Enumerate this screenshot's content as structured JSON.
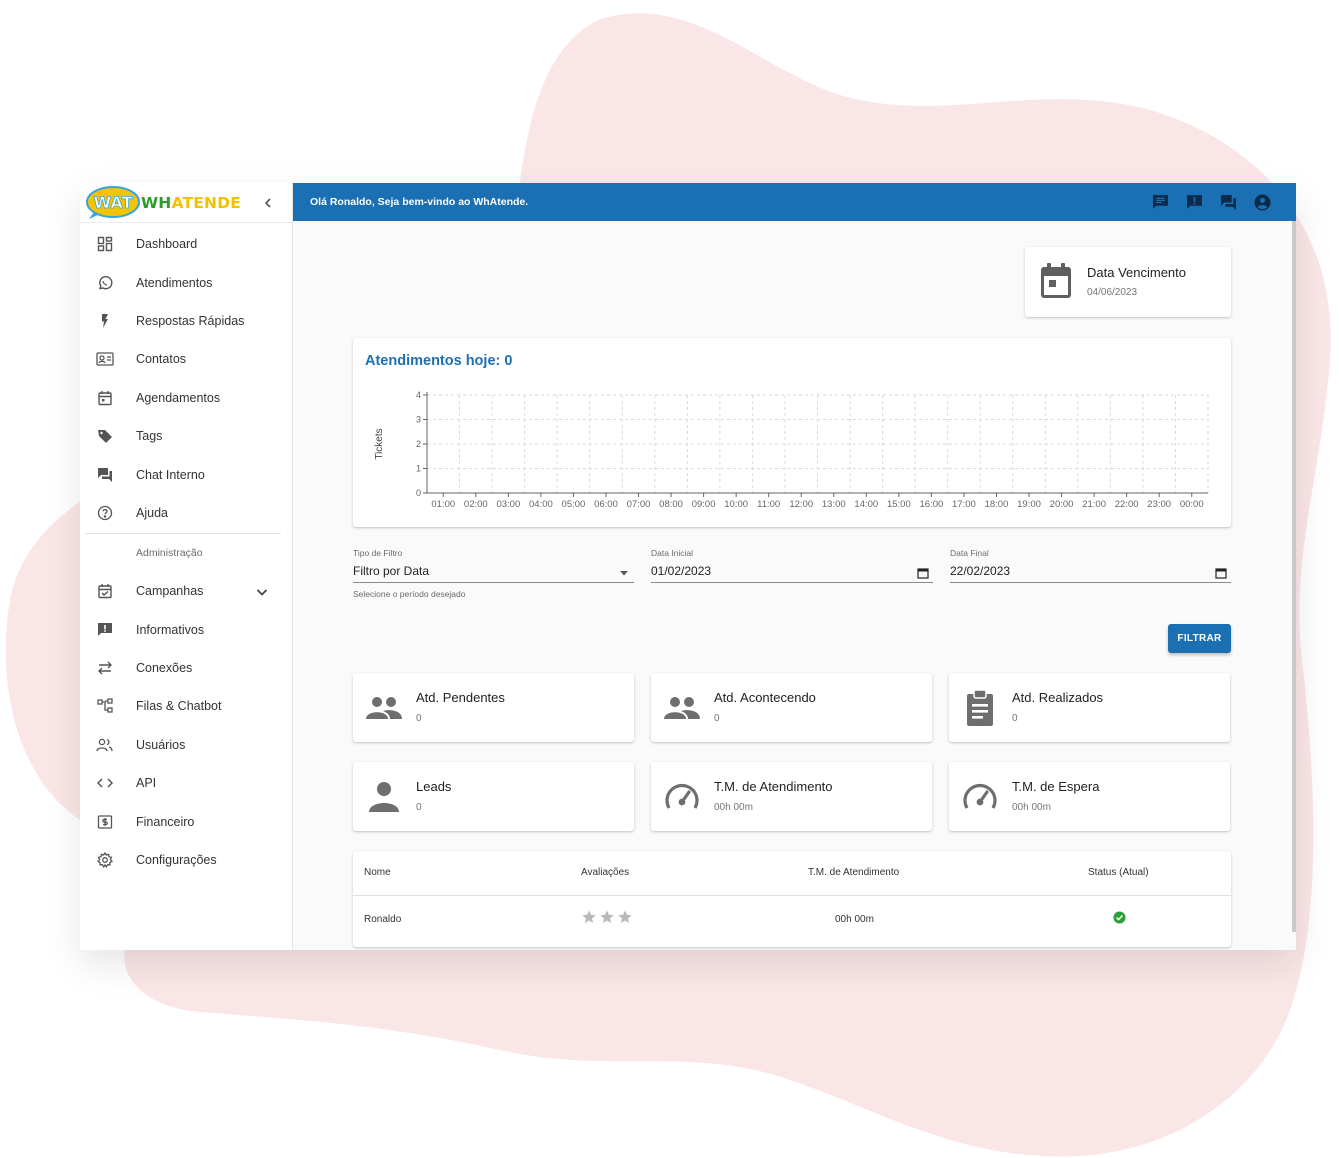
{
  "brand": {
    "logo_badge": "WAT",
    "logo_name_part1": "WH",
    "logo_name_part2": "ATENDE",
    "logo_icon": "wat-logo-icon"
  },
  "sidebar": {
    "collapse_icon": "chevron-left-icon",
    "items": [
      {
        "label": "Dashboard",
        "icon": "dashboard-icon"
      },
      {
        "label": "Atendimentos",
        "icon": "whatsapp-icon"
      },
      {
        "label": "Respostas Rápidas",
        "icon": "flash-icon"
      },
      {
        "label": "Contatos",
        "icon": "contacts-icon"
      },
      {
        "label": "Agendamentos",
        "icon": "calendar-icon"
      },
      {
        "label": "Tags",
        "icon": "tag-icon"
      },
      {
        "label": "Chat Interno",
        "icon": "forum-icon"
      },
      {
        "label": "Ajuda",
        "icon": "help-icon"
      }
    ],
    "admin_header": "Administração",
    "admin_items": [
      {
        "label": "Campanhas",
        "icon": "event-available-icon"
      },
      {
        "label": "Informativos",
        "icon": "announcement-icon"
      },
      {
        "label": "Conexões",
        "icon": "sync-alt-icon"
      },
      {
        "label": "Filas & Chatbot",
        "icon": "account-tree-icon"
      },
      {
        "label": "Usuários",
        "icon": "people-icon"
      },
      {
        "label": "API",
        "icon": "code-icon"
      },
      {
        "label": "Financeiro",
        "icon": "money-icon"
      },
      {
        "label": "Configurações",
        "icon": "settings-icon"
      }
    ]
  },
  "topbar": {
    "greeting": "Olá Ronaldo, Seja bem-vindo ao WhAtende.",
    "icons": [
      "chat-icon",
      "announcement-icon",
      "forum-icon",
      "account-circle-icon"
    ]
  },
  "due": {
    "title": "Data Vencimento",
    "date": "04/06/2023",
    "icon": "calendar-icon"
  },
  "chart_data": {
    "type": "line",
    "title": "Atendimentos hoje: 0",
    "ylabel": "Tickets",
    "xlabel": "",
    "categories": [
      "01:00",
      "02:00",
      "03:00",
      "04:00",
      "05:00",
      "06:00",
      "07:00",
      "08:00",
      "09:00",
      "10:00",
      "11:00",
      "12:00",
      "13:00",
      "14:00",
      "15:00",
      "16:00",
      "17:00",
      "18:00",
      "19:00",
      "20:00",
      "21:00",
      "22:00",
      "23:00",
      "00:00"
    ],
    "values": [
      0,
      0,
      0,
      0,
      0,
      0,
      0,
      0,
      0,
      0,
      0,
      0,
      0,
      0,
      0,
      0,
      0,
      0,
      0,
      0,
      0,
      0,
      0,
      0
    ],
    "yticks": [
      0,
      1,
      2,
      3,
      4
    ],
    "ylim": [
      0,
      4
    ],
    "grid": true,
    "colors": {
      "line": "#1b6fb3",
      "grid": "#d9d9d9"
    }
  },
  "filters": {
    "type": {
      "label": "Tipo de Filtro",
      "value": "Filtro por Data",
      "helper": "Selecione o período desejado"
    },
    "start": {
      "label": "Data Inicial",
      "value": "01/02/2023"
    },
    "end": {
      "label": "Data Final",
      "value": "22/02/2023"
    },
    "button": "FILTRAR"
  },
  "stats": [
    {
      "title": "Atd. Pendentes",
      "value": "0",
      "icon": "group-icon"
    },
    {
      "title": "Atd. Acontecendo",
      "value": "0",
      "icon": "group-icon"
    },
    {
      "title": "Atd. Realizados",
      "value": "0",
      "icon": "assignment-icon"
    },
    {
      "title": "Leads",
      "value": "0",
      "icon": "person-icon"
    },
    {
      "title": "T.M. de Atendimento",
      "value": "00h 00m",
      "icon": "speed-icon"
    },
    {
      "title": "T.M. de Espera",
      "value": "00h 00m",
      "icon": "speed-icon"
    }
  ],
  "table": {
    "headers": [
      "Nome",
      "Avaliações",
      "T.M. de Atendimento",
      "Status (Atual)"
    ],
    "rows": [
      {
        "name": "Ronaldo",
        "rating": 0,
        "rating_max": 3,
        "tm": "00h 00m",
        "status": "online"
      }
    ]
  },
  "colors": {
    "primary": "#1b6fb3",
    "status_online": "#2e9e3b",
    "star_empty": "#b9b9b9",
    "blob": "#fbe6e7"
  }
}
